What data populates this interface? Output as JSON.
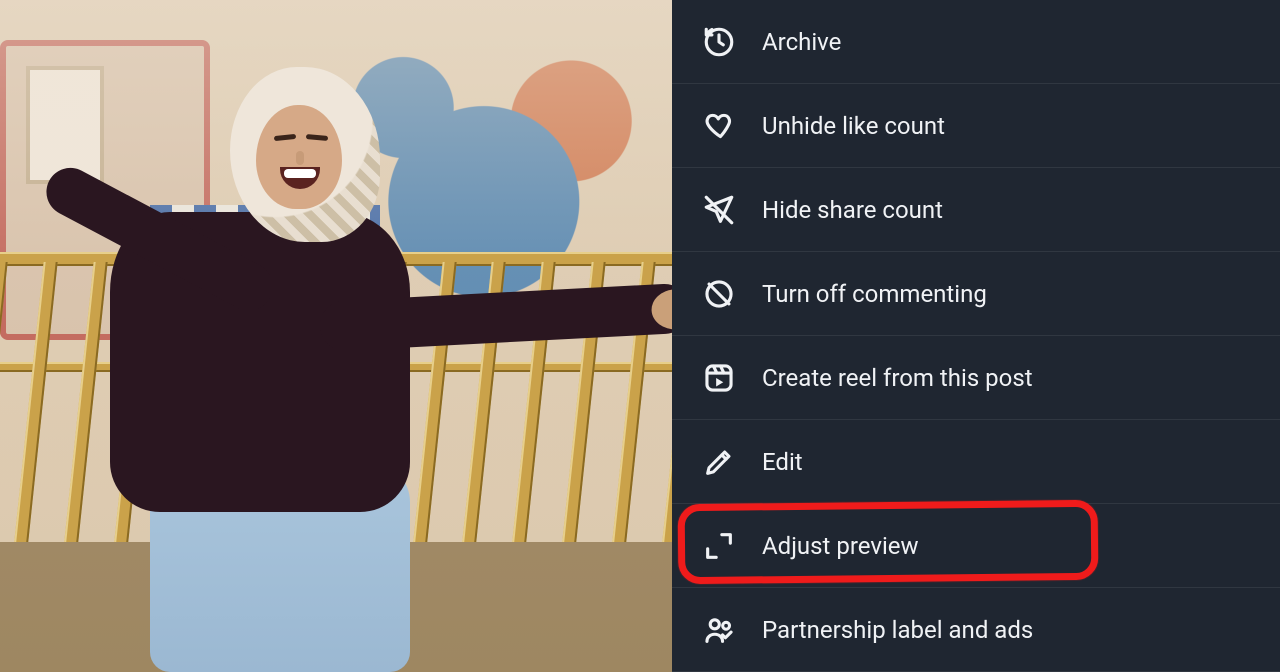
{
  "menu": {
    "items": [
      {
        "key": "archive",
        "label": "Archive",
        "icon": "archive-icon"
      },
      {
        "key": "unhide_likes",
        "label": "Unhide like count",
        "icon": "heart-icon"
      },
      {
        "key": "hide_shares",
        "label": "Hide share count",
        "icon": "share-off-icon"
      },
      {
        "key": "comment_off",
        "label": "Turn off commenting",
        "icon": "comment-off-icon"
      },
      {
        "key": "create_reel",
        "label": "Create reel from this post",
        "icon": "reel-icon"
      },
      {
        "key": "edit",
        "label": "Edit",
        "icon": "pencil-icon"
      },
      {
        "key": "adjust_preview",
        "label": "Adjust preview",
        "icon": "expand-icon"
      },
      {
        "key": "partnership",
        "label": "Partnership label and ads",
        "icon": "partnership-icon"
      }
    ],
    "highlighted_key": "adjust_preview"
  },
  "photo": {
    "alt": "Person in dark sweater and patterned hijab laughing, leaning on a gold railing at an indoor theme park"
  },
  "colors": {
    "panel_bg": "#1f2631",
    "text": "#f0f2f5",
    "divider": "rgba(255,255,255,0.08)",
    "highlight": "#ef1b1b"
  }
}
